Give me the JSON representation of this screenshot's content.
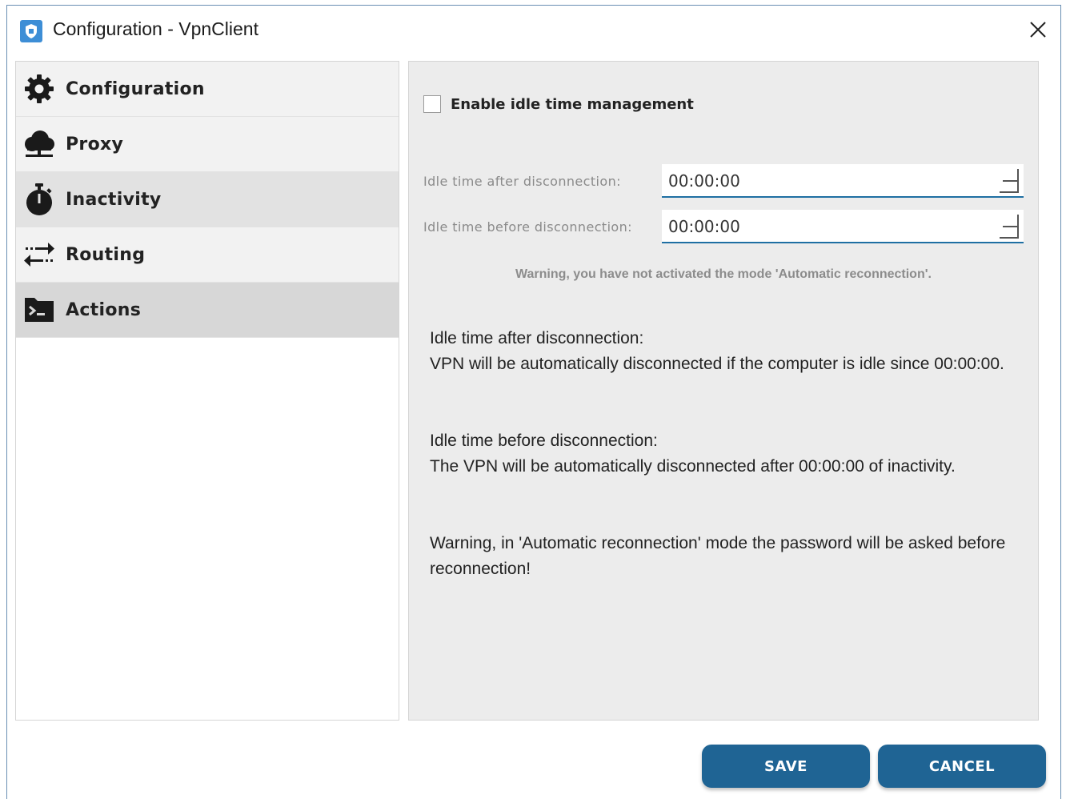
{
  "window": {
    "title": "Configuration - VpnClient",
    "app_icon": "shield-icon",
    "close_icon": "close-icon"
  },
  "sidebar": {
    "items": [
      {
        "label": "Configuration",
        "icon": "gear-icon"
      },
      {
        "label": "Proxy",
        "icon": "cloud-icon"
      },
      {
        "label": "Inactivity",
        "icon": "stopwatch-icon"
      },
      {
        "label": "Routing",
        "icon": "routing-arrows-icon"
      },
      {
        "label": "Actions",
        "icon": "terminal-icon"
      }
    ]
  },
  "panel": {
    "enable_checkbox": {
      "label": "Enable idle time management",
      "checked": false
    },
    "after_label": "Idle time after disconnection:",
    "after_value": "00:00:00",
    "before_label": "Idle time before disconnection:",
    "before_value": "00:00:00",
    "warning_small": "Warning, you have not activated the mode 'Automatic reconnection'.",
    "info1_title": "Idle time after disconnection:",
    "info1_text": "VPN will be automatically disconnected if the computer is idle since 00:00:00.",
    "info2_title": "Idle time before disconnection:",
    "info2_text": "The VPN will be automatically disconnected after 00:00:00 of inactivity.",
    "warning_big": "Warning, in 'Automatic reconnection' mode the password will be asked before reconnection!"
  },
  "footer": {
    "save_label": "SAVE",
    "cancel_label": "CANCEL"
  },
  "colors": {
    "accent": "#1f6494",
    "input_underline": "#1f6fa3",
    "app_icon": "#3d8ed6"
  }
}
